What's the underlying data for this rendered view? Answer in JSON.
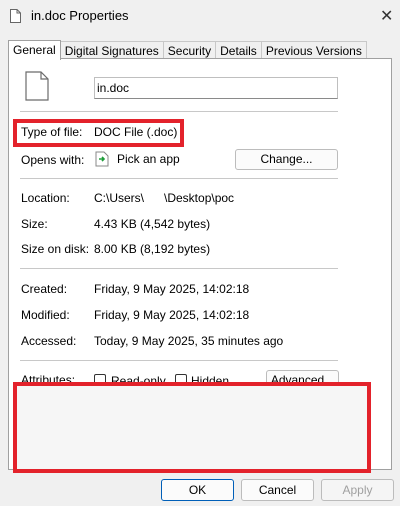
{
  "window": {
    "title": "in.doc Properties"
  },
  "tabs": [
    "General",
    "Digital Signatures",
    "Security",
    "Details",
    "Previous Versions"
  ],
  "file": {
    "name": "in.doc"
  },
  "type_of_file": {
    "label": "Type of file:",
    "value": "DOC File (.doc)"
  },
  "opens_with": {
    "label": "Opens with:",
    "app": "Pick an app",
    "change_label": "Change..."
  },
  "location": {
    "label": "Location:",
    "value": "C:\\Users\\      \\Desktop\\poc"
  },
  "size": {
    "label": "Size:",
    "value": "4.43 KB (4,542 bytes)"
  },
  "size_on_disk": {
    "label": "Size on disk:",
    "value": "8.00 KB (8,192 bytes)"
  },
  "created": {
    "label": "Created:",
    "value": "Friday, 9 May 2025, 14:02:18"
  },
  "modified": {
    "label": "Modified:",
    "value": "Friday, 9 May 2025, 14:02:18"
  },
  "accessed": {
    "label": "Accessed:",
    "value": "Today, 9 May 2025, 35 minutes ago"
  },
  "attributes": {
    "label": "Attributes:",
    "readonly": "Read-only",
    "hidden": "Hidden",
    "advanced": "Advanced..."
  },
  "buttons": {
    "ok": "OK",
    "cancel": "Cancel",
    "apply": "Apply"
  },
  "colors": {
    "highlight": "#e3222b",
    "accent": "#005fb8"
  }
}
